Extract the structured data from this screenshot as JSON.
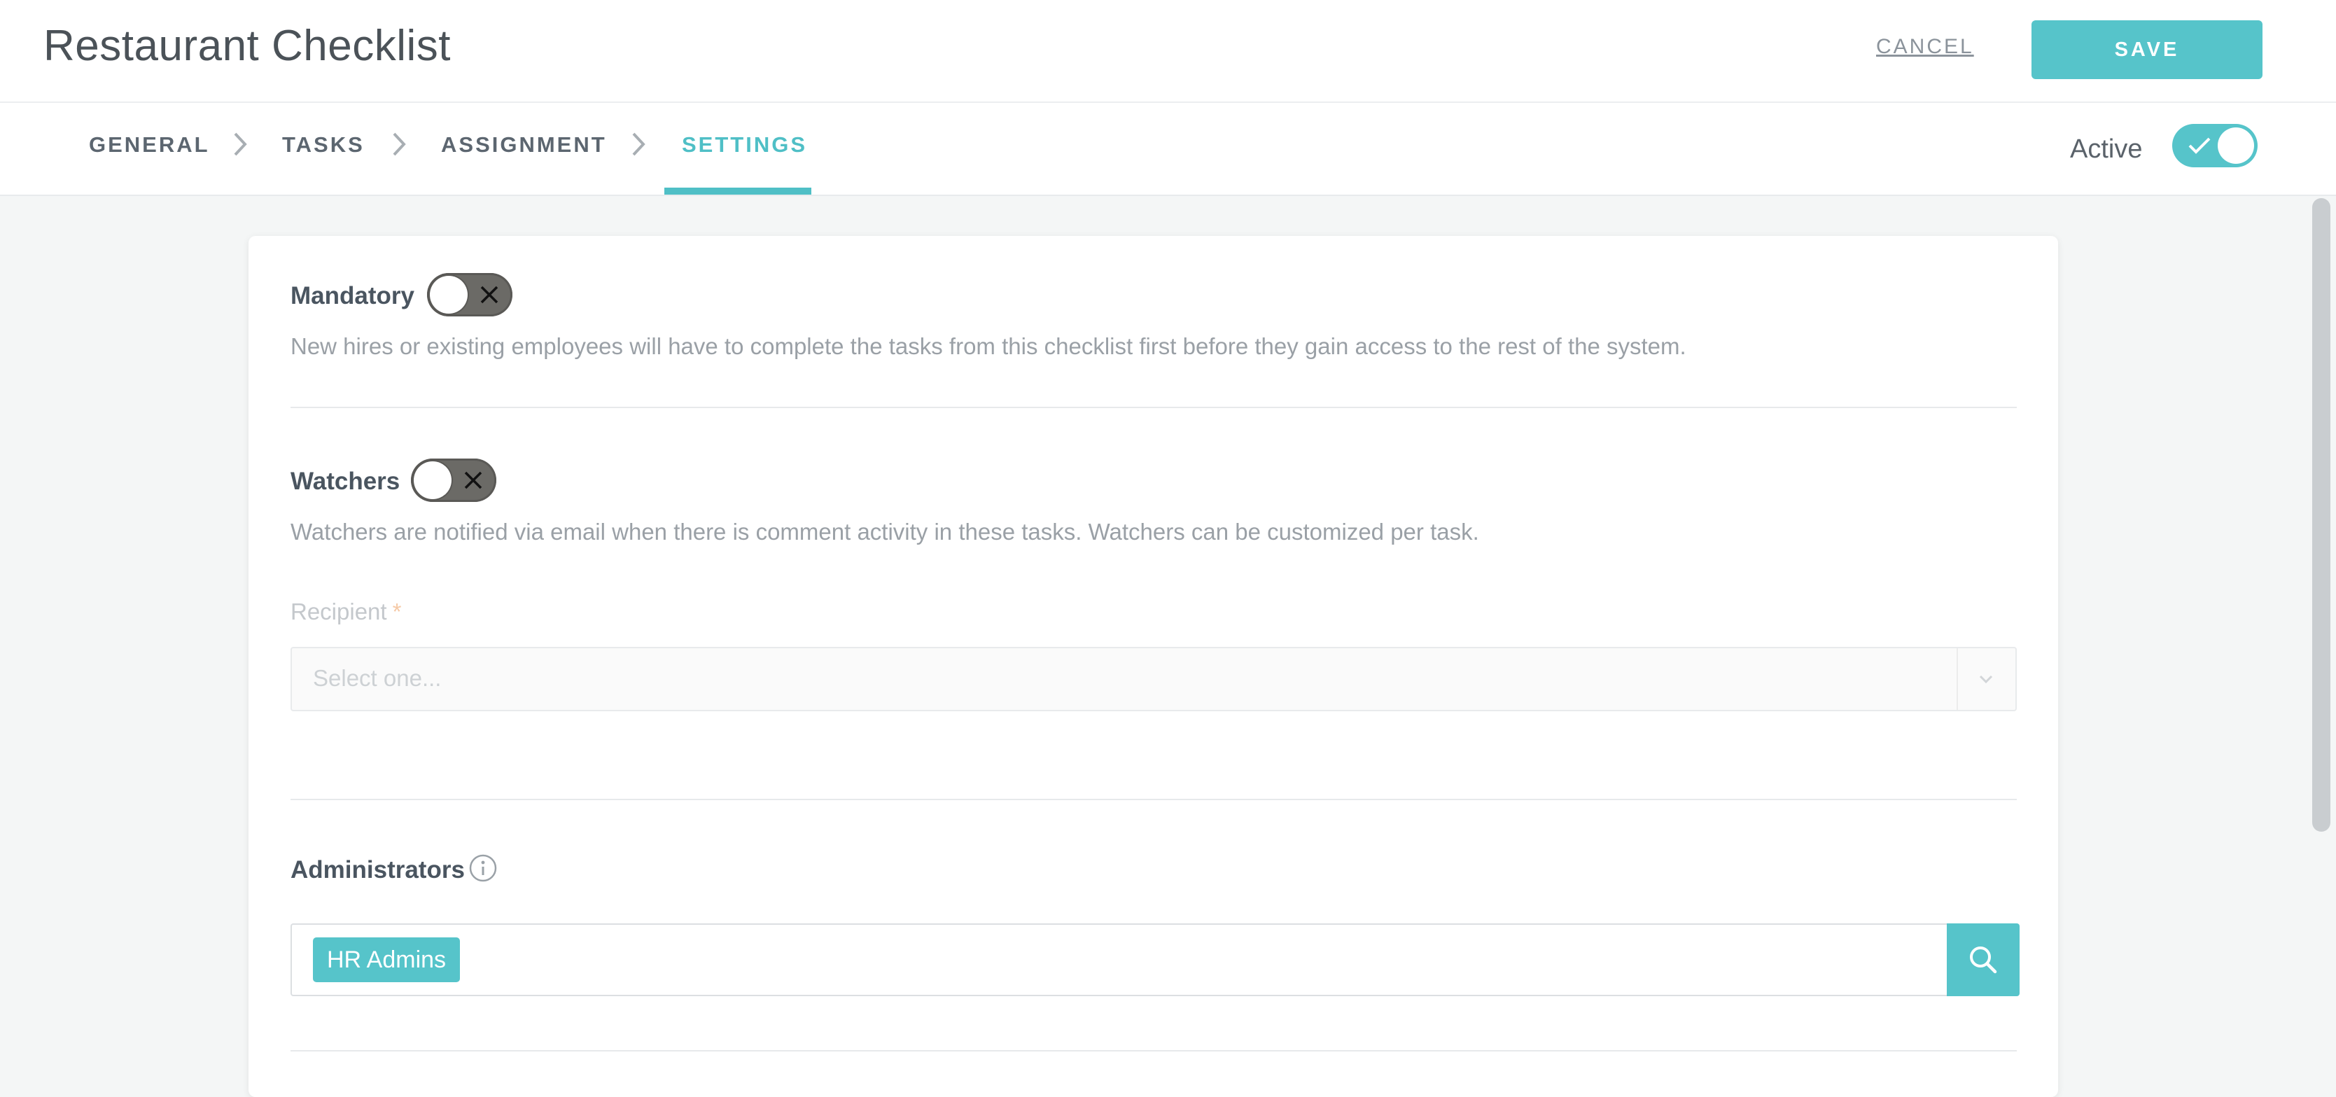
{
  "header": {
    "title": "Restaurant Checklist",
    "cancel_label": "CANCEL",
    "save_label": "SAVE"
  },
  "steps": [
    {
      "label": "GENERAL",
      "active": false
    },
    {
      "label": "TASKS",
      "active": false
    },
    {
      "label": "ASSIGNMENT",
      "active": false
    },
    {
      "label": "SETTINGS",
      "active": true
    }
  ],
  "status": {
    "active_label": "Active",
    "active_on": true
  },
  "settings": {
    "mandatory": {
      "label": "Mandatory",
      "enabled": false,
      "description": "New hires or existing employees will have to complete the tasks from this checklist first before they gain access to the rest of the system."
    },
    "watchers": {
      "label": "Watchers",
      "enabled": false,
      "description": "Watchers are notified via email when there is comment activity in these tasks. Watchers can be customized per task."
    },
    "recipient": {
      "label": "Recipient",
      "required_mark": "*",
      "placeholder": "Select one..."
    },
    "administrators": {
      "label": "Administrators",
      "tags": [
        "HR Admins"
      ]
    }
  },
  "colors": {
    "accent": "#56c4ca",
    "toggle_off": "#6b6a66",
    "background": "#f4f6f6"
  },
  "icons": [
    "chevron-right-icon",
    "check-icon",
    "x-icon",
    "chevron-down-icon",
    "info-icon",
    "search-icon"
  ]
}
